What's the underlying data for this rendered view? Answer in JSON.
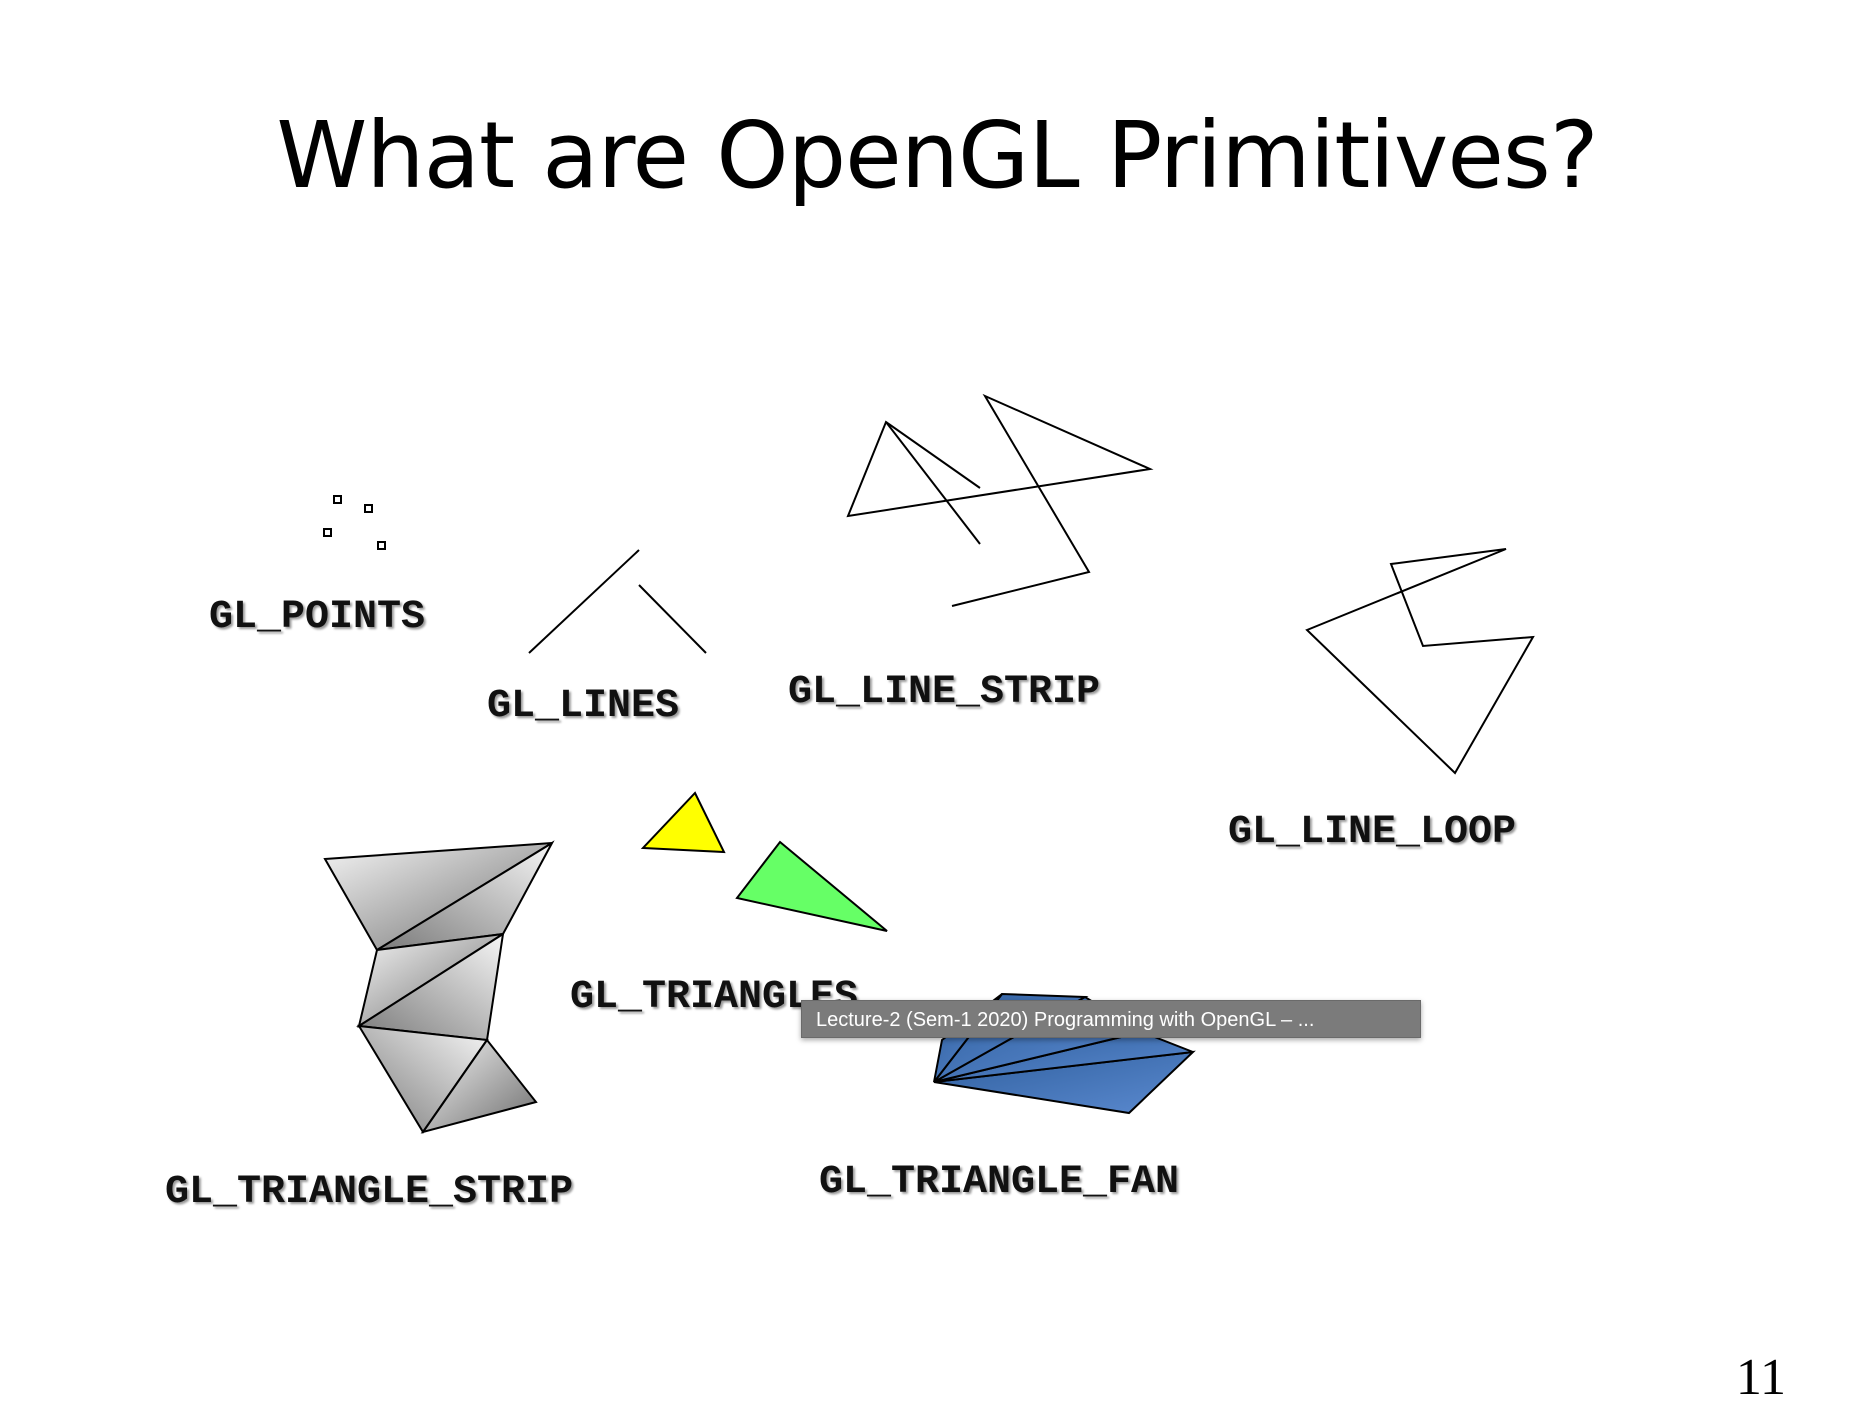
{
  "slide": {
    "title": "What are OpenGL Primitives?",
    "page_number": "11"
  },
  "primitives": {
    "points": {
      "label": "GL_POINTS"
    },
    "lines": {
      "label": "GL_LINES"
    },
    "line_strip": {
      "label": "GL_LINE_STRIP"
    },
    "line_loop": {
      "label": "GL_LINE_LOOP"
    },
    "triangles": {
      "label": "GL_TRIANGLES",
      "colors": [
        "#ffff00",
        "#66ff66"
      ]
    },
    "triangle_strip": {
      "label": "GL_TRIANGLE_STRIP",
      "colors": [
        "#f2f2f2",
        "#7f7f7f"
      ]
    },
    "triangle_fan": {
      "label": "GL_TRIANGLE_FAN",
      "color": "#4a78b8"
    }
  },
  "tooltip": {
    "text": "Lecture-2 (Sem-1 2020) Programming with OpenGL – ..."
  }
}
